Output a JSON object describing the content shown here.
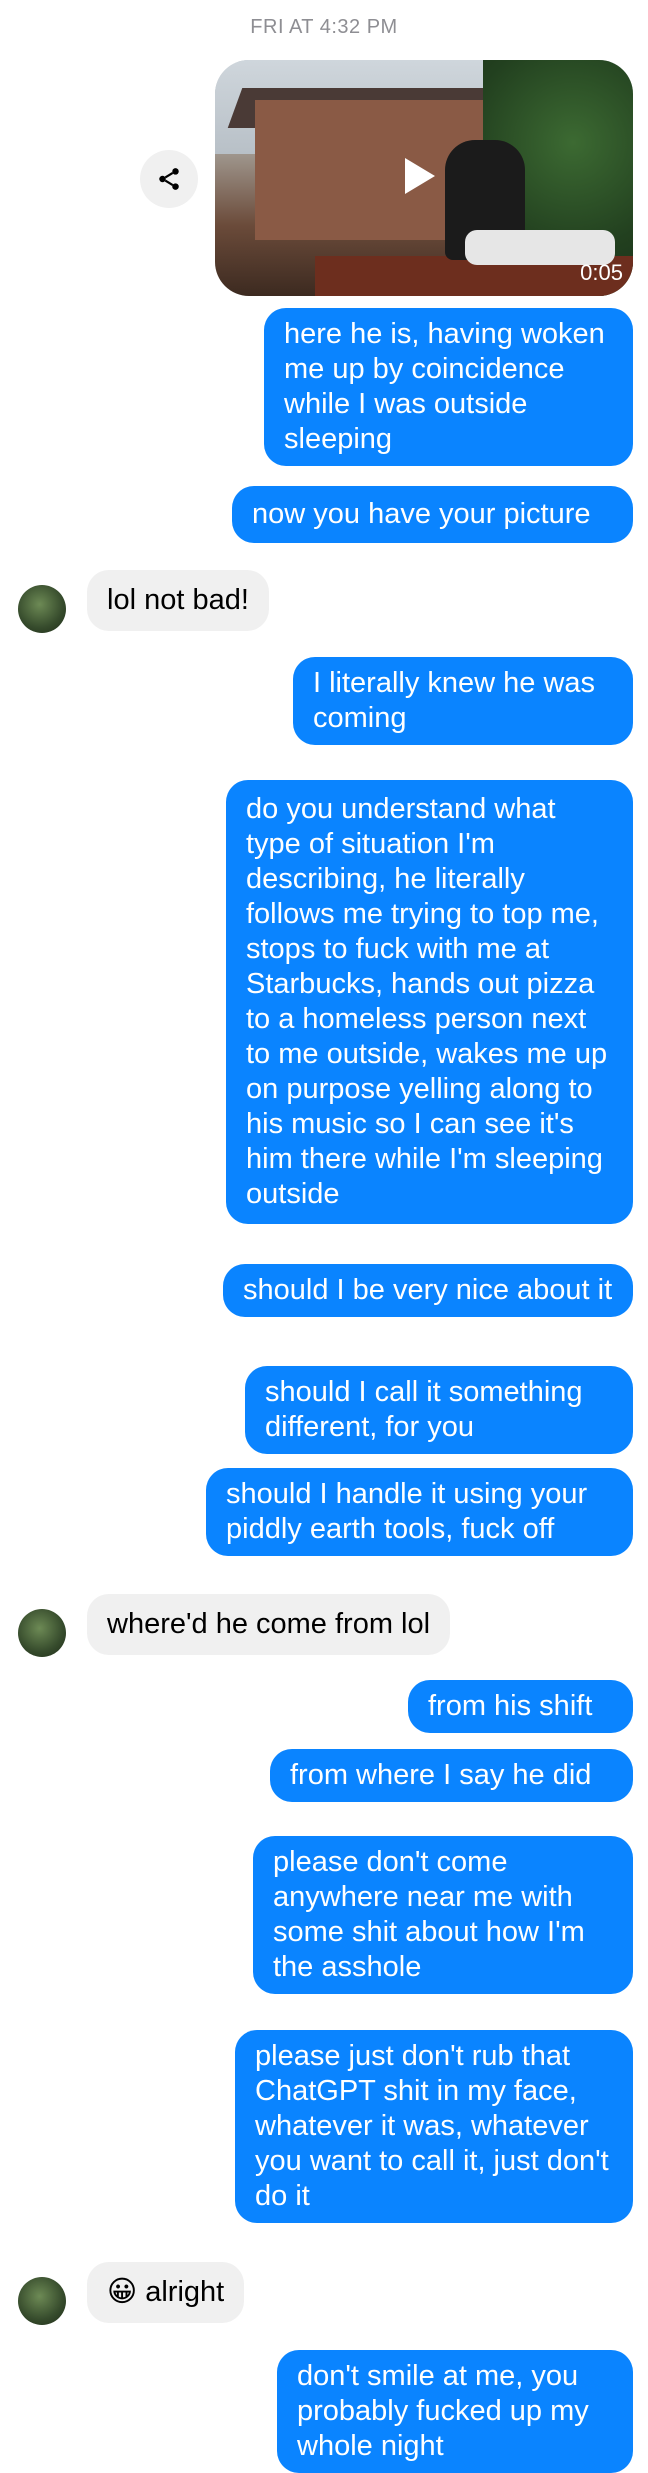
{
  "header": {
    "timestamp": "FRI AT 4:32 PM"
  },
  "video": {
    "duration": "0:05",
    "share_icon": "share-icon",
    "play_icon": "play-icon"
  },
  "messages": [
    {
      "dir": "out",
      "text": "here he is, having woken me up by coincidence while I was outside sleeping"
    },
    {
      "dir": "out",
      "text": "now you have your picture"
    },
    {
      "dir": "in",
      "text": "lol not bad!"
    },
    {
      "dir": "out",
      "text": "I literally knew he was coming"
    },
    {
      "dir": "out",
      "text": "do you understand what type of situation I'm describing, he literally follows me trying to top me, stops to fuck with me at Starbucks, hands out pizza to a homeless person next to me outside, wakes me up on purpose yelling along to his music so I can see it's him there while I'm sleeping outside"
    },
    {
      "dir": "out",
      "text": "should I be very nice about it"
    },
    {
      "dir": "out",
      "text": "should I call it something different, for you"
    },
    {
      "dir": "out",
      "text": "should I handle it using your piddly earth tools, fuck off"
    },
    {
      "dir": "in",
      "text": "where'd he come from lol"
    },
    {
      "dir": "out",
      "text": "from his shift"
    },
    {
      "dir": "out",
      "text": "from where I say he did"
    },
    {
      "dir": "out",
      "text": "please don't come anywhere near me with some shit about how I'm the asshole"
    },
    {
      "dir": "out",
      "text": "please just don't rub that ChatGPT shit in my face, whatever it was, whatever you want to call it, just don't do it"
    },
    {
      "dir": "in",
      "text": "alright",
      "emoji": "😀"
    },
    {
      "dir": "out",
      "text": "don't smile at me, you probably fucked up my whole night"
    }
  ]
}
